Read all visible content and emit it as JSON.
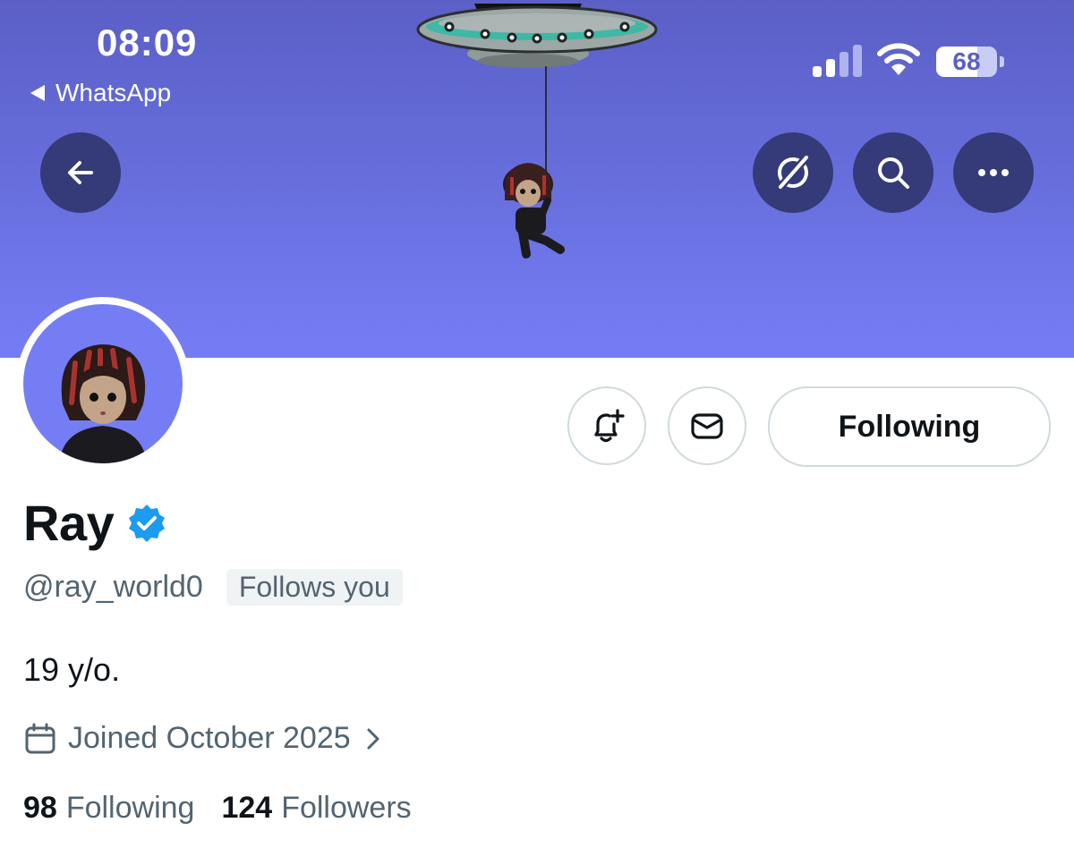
{
  "status_bar": {
    "time": "08:09",
    "back_app": "WhatsApp",
    "battery_level": "68",
    "battery_fraction": 0.68
  },
  "header_actions": {
    "back_icon": "arrow-left-icon",
    "grok_icon": "grok-slash-icon",
    "search_icon": "search-icon",
    "more_icon": "more-horizontal-icon"
  },
  "profile": {
    "display_name": "Ray",
    "verified": true,
    "handle": "@ray_world0",
    "follows_you": "Follows you",
    "bio": "19 y/o.",
    "joined": "Joined October 2025",
    "following_count": "98",
    "following_label": "Following",
    "followers_count": "124",
    "followers_label": "Followers"
  },
  "actions": {
    "notify_icon": "bell-plus-icon",
    "message_icon": "envelope-icon",
    "following_button": "Following"
  },
  "colors": {
    "banner_top": "#5b5fc6",
    "banner_bottom": "#757df5",
    "header_button": "#353a78",
    "verified_blue": "#1d9bf0",
    "text_primary": "#0f1419",
    "text_secondary": "#536471"
  }
}
